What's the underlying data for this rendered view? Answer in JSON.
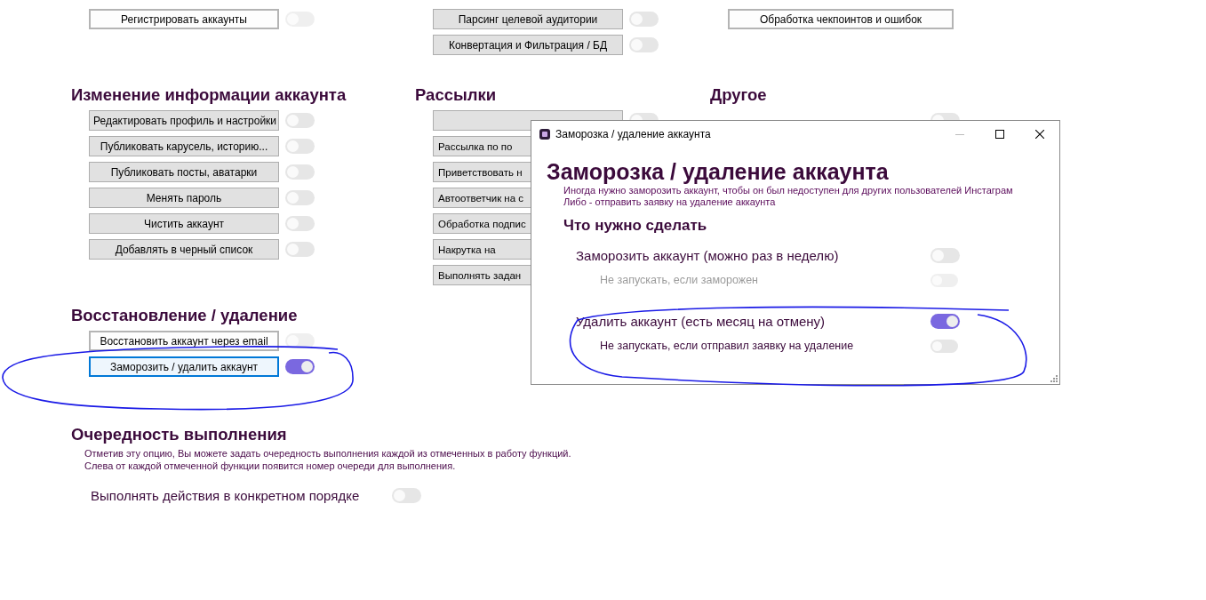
{
  "columns": [
    {
      "groups": [
        {
          "actions": [
            {
              "kind": "outlined",
              "label": "Регистрировать аккаунты",
              "toggle_on": false
            }
          ]
        },
        {
          "heading": "Изменение информации аккаунта",
          "actions": [
            {
              "kind": "button",
              "label": "Редактировать профиль и настройки",
              "toggle_on": false
            },
            {
              "kind": "button",
              "label": "Публиковать карусель, историю...",
              "toggle_on": false
            },
            {
              "kind": "button",
              "label": "Публиковать посты, аватарки",
              "toggle_on": false
            },
            {
              "kind": "button",
              "label": "Менять пароль",
              "toggle_on": false
            },
            {
              "kind": "button",
              "label": "Чистить аккаунт",
              "toggle_on": false
            },
            {
              "kind": "button",
              "label": "Добавлять в черный список",
              "toggle_on": false
            }
          ]
        },
        {
          "heading": "Восстановление / удаление",
          "actions": [
            {
              "kind": "outlined",
              "label": "Восстановить аккаунт через email",
              "toggle_on": false
            },
            {
              "kind": "focused",
              "label": "Заморозить / удалить аккаунт",
              "toggle_on": true
            }
          ]
        }
      ]
    },
    {
      "groups": [
        {
          "actions": [
            {
              "kind": "button",
              "label": "Парсинг целевой аудитории",
              "toggle_on": false
            },
            {
              "kind": "button",
              "label": "Конвертация и Фильтрация / БД",
              "toggle_on": false
            }
          ]
        },
        {
          "heading": "Рассылки",
          "actions": [
            {
              "kind": "covered",
              "toggle_on": false
            },
            {
              "kind": "cut",
              "label": "Рассылка по по"
            },
            {
              "kind": "cut",
              "label": "Приветствовать н"
            },
            {
              "kind": "cut",
              "label": "Автоответчик на с"
            },
            {
              "kind": "cut",
              "label": "Обработка подпис"
            },
            {
              "kind": "cut",
              "label": "Накрутка на"
            },
            {
              "kind": "cut",
              "label": "Выполнять задан"
            }
          ]
        }
      ]
    },
    {
      "groups": [
        {
          "actions": [
            {
              "kind": "outlined",
              "label": "Обработка чекпоинтов и ошибок"
            }
          ]
        },
        {
          "heading": "Другое",
          "actions": [
            {
              "kind": "covered_switch",
              "toggle_on": false
            }
          ]
        }
      ]
    }
  ],
  "order_section": {
    "heading": "Очередность выполнения",
    "description": [
      "Отметив эту опцию, Вы можете задать очередность выполнения каждой из отмеченных в работу функций.",
      "Слева от каждой отмеченной функции появится номер очереди для выполнения."
    ],
    "option": {
      "label": "Выполнять действия в конкретном порядке",
      "on": false
    }
  },
  "dialog": {
    "title": "Заморозка / удаление аккаунта",
    "heading": "Заморозка / удаление аккаунта",
    "description": [
      "Иногда нужно заморозить аккаунт, чтобы он был недоступен для других пользователей Инстаграм",
      "Либо - отправить заявку на удаление аккаунта"
    ],
    "subheading": "Что нужно сделать",
    "options": [
      {
        "label": "Заморозить аккаунт (можно раз в неделю)",
        "on": false,
        "children": [
          {
            "label": "Не запускать, если заморожен",
            "on": false,
            "disabled": true
          }
        ]
      },
      {
        "label": "Удалить аккаунт (есть месяц на отмену)",
        "on": true,
        "children": [
          {
            "label": "Не запускать, если отправил заявку на удаление",
            "on": false,
            "disabled": false
          }
        ]
      }
    ]
  }
}
